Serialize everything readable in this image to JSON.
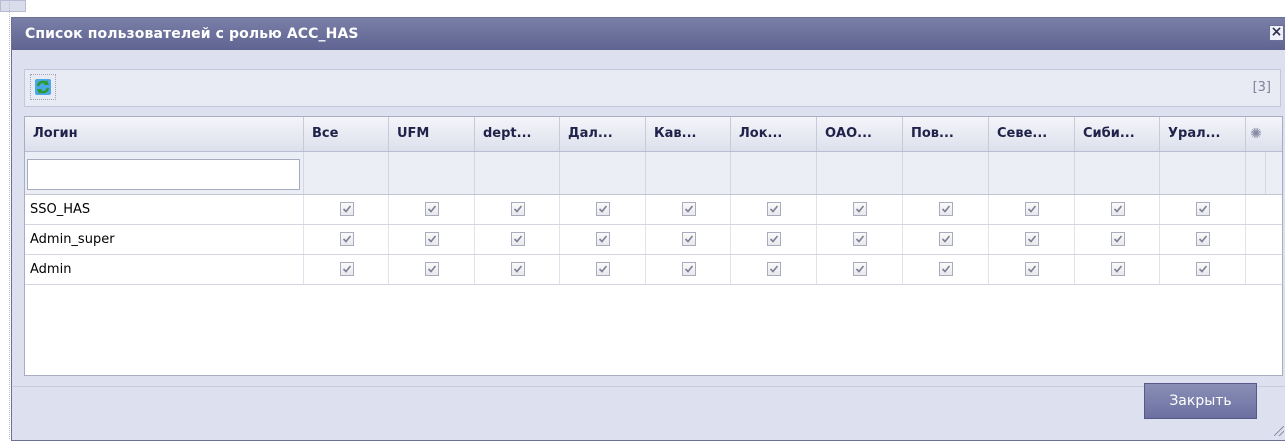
{
  "dialog": {
    "title": "Список пользователей с ролью ACC_HAS",
    "close_icon": "close-icon"
  },
  "toolbar": {
    "refresh_icon": "refresh-icon",
    "row_count": "[3]"
  },
  "grid": {
    "columns": [
      {
        "label": "Логин"
      },
      {
        "label": "Все"
      },
      {
        "label": "UFM"
      },
      {
        "label": "dept..."
      },
      {
        "label": "Дал..."
      },
      {
        "label": "Кав..."
      },
      {
        "label": "Лок..."
      },
      {
        "label": "ОАО..."
      },
      {
        "label": "Пов..."
      },
      {
        "label": "Севе..."
      },
      {
        "label": "Сиби..."
      },
      {
        "label": "Урал..."
      }
    ],
    "settings_icon": "gear-icon",
    "filter": {
      "value": "",
      "placeholder": ""
    },
    "rows": [
      {
        "login": "SSO_HAS",
        "checked": [
          true,
          true,
          true,
          true,
          true,
          true,
          true,
          true,
          true,
          true,
          true
        ]
      },
      {
        "login": "Admin_super",
        "checked": [
          true,
          true,
          true,
          true,
          true,
          true,
          true,
          true,
          true,
          true,
          true
        ]
      },
      {
        "login": "Admin",
        "checked": [
          true,
          true,
          true,
          true,
          true,
          true,
          true,
          true,
          true,
          true,
          true
        ]
      }
    ]
  },
  "footer": {
    "close_label": "Закрыть"
  },
  "colors": {
    "titlebar": "#6a6f9c",
    "dialog_bg": "#dde0ee",
    "button": "#7a7fab"
  }
}
